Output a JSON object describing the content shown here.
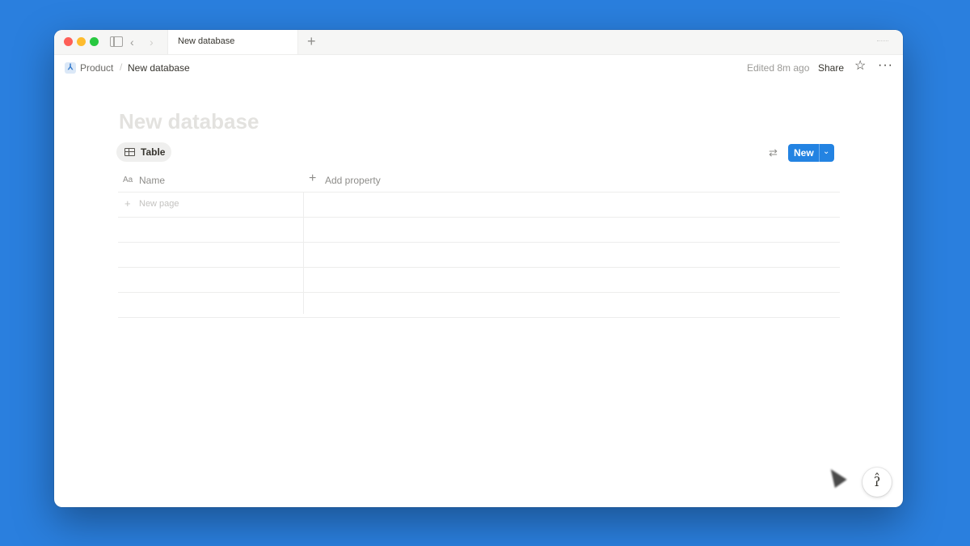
{
  "tab": {
    "title": "New database"
  },
  "breadcrumb": {
    "workspace": "Product",
    "page": "New database"
  },
  "topbar": {
    "edited": "Edited 8m ago",
    "share": "Share"
  },
  "page": {
    "title": "New database"
  },
  "views": [
    {
      "label": "Table",
      "icon": "table-icon"
    }
  ],
  "toolbar": {
    "new_label": "New"
  },
  "table": {
    "columns": [
      {
        "label": "Name",
        "icon": "text-property-icon"
      }
    ],
    "add_property": "Add property",
    "new_page": "New page",
    "empty_rows": 4
  },
  "colors": {
    "accent": "#2383e2",
    "background": "#2a7fde"
  }
}
